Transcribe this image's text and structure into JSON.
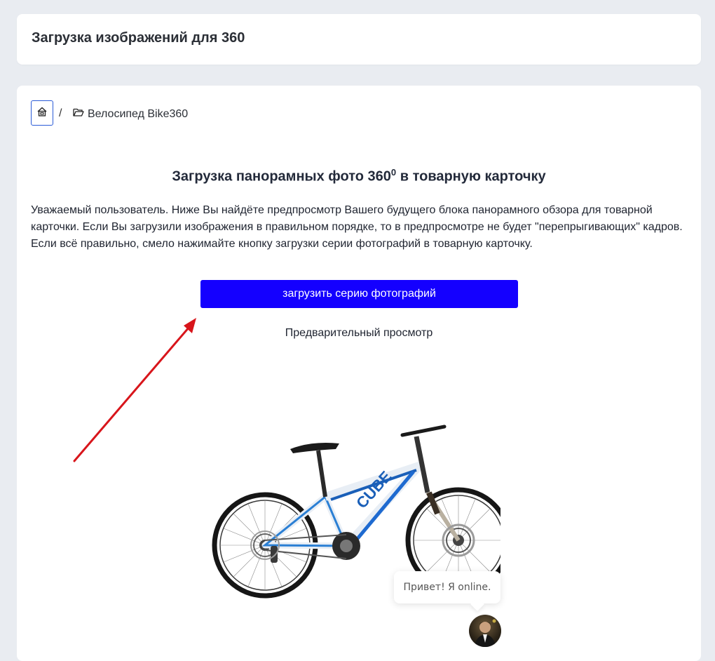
{
  "header": {
    "title": "Загрузка изображений для 360"
  },
  "breadcrumb": {
    "separator": "/",
    "current": "Велосипед Bike360"
  },
  "section": {
    "title": "Загрузка панорамных фото 360",
    "title_sup": "0",
    "title_suffix": " в товарную карточку"
  },
  "description": "Уважаемый пользователь. Ниже Вы найдёте предпросмотр Вашего будущего блока панорамного обзора для товарной карточки. Если Вы загрузили изображения в правильном порядке, то в предпросмотре не будет \"перепрыгивающих\" кадров. Если всё правильно, смело нажимайте кнопку загрузки серии фотографий в товарную карточку.",
  "upload_button": {
    "label": "загрузить серию фотографий"
  },
  "preview": {
    "label": "Предварительный просмотр"
  },
  "bike_brand": {
    "text": "CUBE"
  },
  "chat": {
    "bubble_text": "Привет! Я online."
  },
  "colors": {
    "accent": "#1400ff",
    "arrow": "#d8151b",
    "background": "#e9ecf1"
  },
  "icons": {
    "home": "home-icon",
    "folder": "folder-open-icon"
  }
}
